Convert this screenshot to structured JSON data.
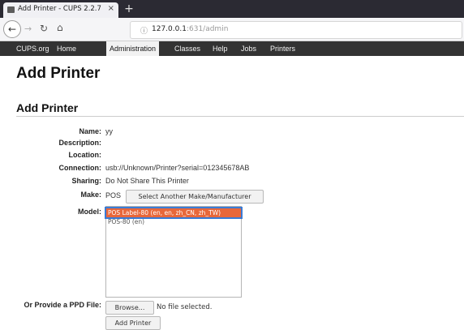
{
  "browser": {
    "tab_title": "Add Printer - CUPS 2.2.7",
    "tab_close": "×",
    "new_tab": "+",
    "url_host": "127.0.0.1",
    "url_rest": ":631/admin"
  },
  "menu": {
    "items": [
      "CUPS.org",
      "Home",
      "Administration",
      "Classes",
      "Help",
      "Jobs",
      "Printers"
    ],
    "active": "Administration"
  },
  "page": {
    "title": "Add Printer",
    "section_title": "Add Printer"
  },
  "form": {
    "name_label": "Name:",
    "name_value": "yy",
    "description_label": "Description:",
    "description_value": "",
    "location_label": "Location:",
    "location_value": "",
    "connection_label": "Connection:",
    "connection_value": "usb://Unknown/Printer?serial=012345678AB",
    "sharing_label": "Sharing:",
    "sharing_value": "Do Not Share This Printer",
    "make_label": "Make:",
    "make_value": "POS",
    "select_make_button": "Select Another Make/Manufacturer",
    "model_label": "Model:",
    "model_options": [
      "POS Label-80 (en, en, zh_CN, zh_TW)",
      "POS-80 (en)"
    ],
    "model_selected_index": 0,
    "ppd_label": "Or Provide a PPD File:",
    "browse_button": "Browse...",
    "no_file_text": "No file selected.",
    "add_printer_button": "Add Printer"
  },
  "colors": {
    "menu_bg": "#333333",
    "selected_option_bg": "#e8673a",
    "selection_outline": "#3a7bd5"
  }
}
